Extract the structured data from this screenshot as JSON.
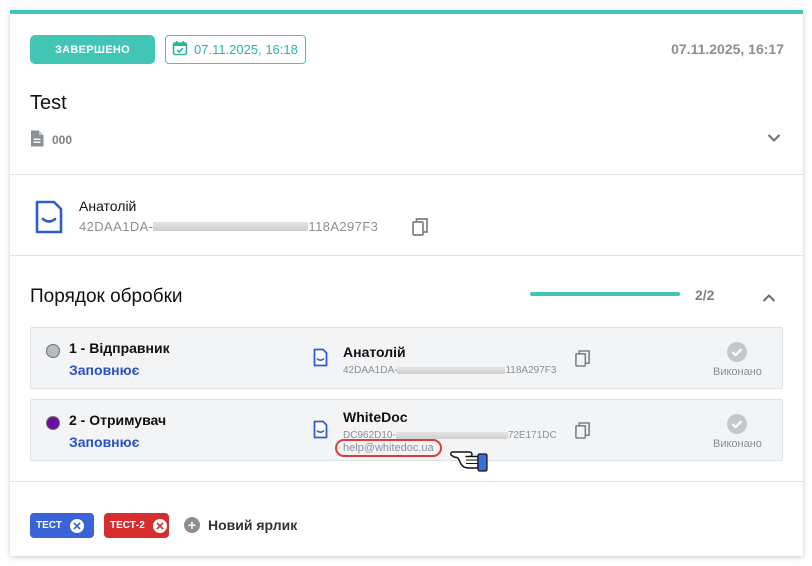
{
  "header": {
    "status": "ЗАВЕРШЕНО",
    "deadline": "07.11.2025, 16:18",
    "created": "07.11.2025, 16:17"
  },
  "document": {
    "title": "Test",
    "number": "000"
  },
  "signer": {
    "name": "Анатолій",
    "key_start": "42DAA1DA-",
    "key_end": "118A297F3"
  },
  "processing": {
    "title": "Порядок обробки",
    "progress_text": "2/2",
    "progress_fraction": 1.0,
    "steps": [
      {
        "role": "1 - Відправник",
        "action": "Заповнює",
        "party": "Анатолій",
        "key_start": "42DAA1DA-",
        "key_end": "118A297F3",
        "status": "Виконано",
        "dot_color": "#b9bbbe"
      },
      {
        "role": "2 - Отримувач",
        "action": "Заповнює",
        "party": "WhiteDoc",
        "key_start": "DC962D10-",
        "key_end": "72E171DC",
        "email": "help@whitedoc.ua",
        "status": "Виконано",
        "dot_color": "#6a0fa0"
      }
    ]
  },
  "tags": [
    {
      "label": "ТЕСТ",
      "color": "#3a63d8"
    },
    {
      "label": "ТЕСТ-2",
      "color": "#d62e2e"
    }
  ],
  "new_tag_label": "Новий ярлик",
  "colors": {
    "accent": "#41c6b6",
    "link": "#2752c7"
  }
}
